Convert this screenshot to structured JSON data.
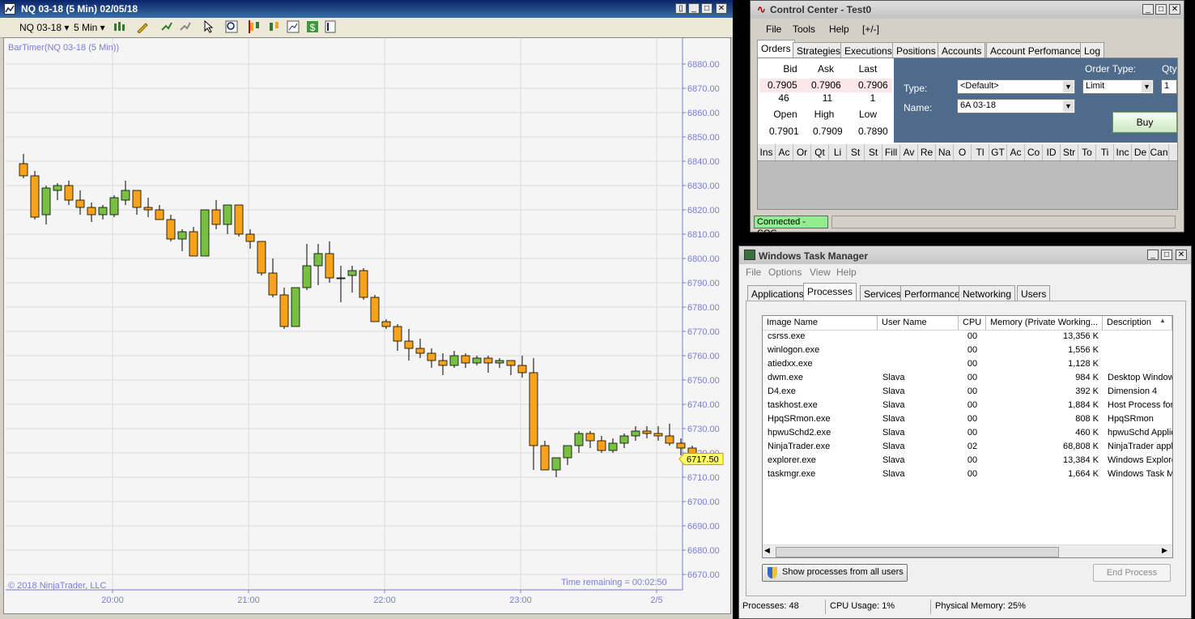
{
  "chart_window": {
    "title": "NQ 03-18 (5 Min)  02/05/18",
    "instrument": "NQ 03-18",
    "interval": "5 Min",
    "indicator_label": "BarTimer(NQ 03-18 (5 Min))",
    "copyright": "© 2018 NinjaTrader, LLC",
    "time_remaining": "Time remaining = 00:02:50",
    "last_price": "6717.50",
    "icons": [
      "bar-type-icon",
      "draw-pencil-icon",
      "add-indicator-icon",
      "strategy-icon",
      "cursor-icon",
      "zoom-icon",
      "chart-style-icon",
      "data-box-icon",
      "panel-icon",
      "dollar-icon",
      "properties-icon"
    ]
  },
  "chart_data": {
    "type": "candlestick",
    "title": "",
    "xlabel": "",
    "ylabel": "",
    "ylim": [
      6665,
      6885
    ],
    "y_ticks": [
      "6880.00",
      "6870.00",
      "6860.00",
      "6850.00",
      "6840.00",
      "6830.00",
      "6820.00",
      "6810.00",
      "6800.00",
      "6790.00",
      "6780.00",
      "6770.00",
      "6760.00",
      "6750.00",
      "6740.00",
      "6730.00",
      "6720.00",
      "6710.00",
      "6700.00",
      "6690.00",
      "6680.00",
      "6670.00"
    ],
    "y_tick_values": [
      6880,
      6870,
      6860,
      6850,
      6840,
      6830,
      6820,
      6810,
      6800,
      6790,
      6780,
      6770,
      6760,
      6750,
      6740,
      6730,
      6720,
      6710,
      6700,
      6690,
      6680,
      6670
    ],
    "x_ticks": [
      "20:00",
      "21:00",
      "22:00",
      "23:00",
      "2/5"
    ],
    "x_tick_bar_index": [
      8,
      20,
      32,
      44,
      56
    ],
    "up_color": "#78c042",
    "down_color": "#f7a21b",
    "candles": [
      {
        "o": 6839.0,
        "h": 6843.0,
        "l": 6833.0,
        "c": 6834.0
      },
      {
        "o": 6834.0,
        "h": 6836.0,
        "l": 6816.0,
        "c": 6817.0
      },
      {
        "o": 6818.0,
        "h": 6830.0,
        "l": 6814.0,
        "c": 6829.0
      },
      {
        "o": 6828.0,
        "h": 6831.0,
        "l": 6824.0,
        "c": 6830.0
      },
      {
        "o": 6830.0,
        "h": 6832.0,
        "l": 6822.0,
        "c": 6824.0
      },
      {
        "o": 6824.0,
        "h": 6828.0,
        "l": 6818.0,
        "c": 6821.0
      },
      {
        "o": 6821.0,
        "h": 6823.0,
        "l": 6815.0,
        "c": 6818.0
      },
      {
        "o": 6818.0,
        "h": 6822.0,
        "l": 6816.0,
        "c": 6821.0
      },
      {
        "o": 6818.0,
        "h": 6826.0,
        "l": 6817.0,
        "c": 6825.0
      },
      {
        "o": 6824.0,
        "h": 6832.0,
        "l": 6822.0,
        "c": 6828.0
      },
      {
        "o": 6828.0,
        "h": 6828.0,
        "l": 6818.0,
        "c": 6821.0
      },
      {
        "o": 6821.0,
        "h": 6825.0,
        "l": 6817.0,
        "c": 6820.0
      },
      {
        "o": 6820.0,
        "h": 6822.0,
        "l": 6816.0,
        "c": 6816.0
      },
      {
        "o": 6816.0,
        "h": 6818.0,
        "l": 6807.0,
        "c": 6808.0
      },
      {
        "o": 6808.0,
        "h": 6812.0,
        "l": 6803.0,
        "c": 6811.0
      },
      {
        "o": 6811.0,
        "h": 6813.0,
        "l": 6801.0,
        "c": 6801.0
      },
      {
        "o": 6801.0,
        "h": 6818.0,
        "l": 6801.0,
        "c": 6820.0
      },
      {
        "o": 6820.0,
        "h": 6824.0,
        "l": 6812.0,
        "c": 6814.0
      },
      {
        "o": 6814.0,
        "h": 6822.0,
        "l": 6810.0,
        "c": 6822.0
      },
      {
        "o": 6822.0,
        "h": 6822.0,
        "l": 6809.0,
        "c": 6810.0
      },
      {
        "o": 6810.0,
        "h": 6812.0,
        "l": 6804.0,
        "c": 6807.0
      },
      {
        "o": 6807.0,
        "h": 6807.0,
        "l": 6793.0,
        "c": 6794.0
      },
      {
        "o": 6794.0,
        "h": 6800.0,
        "l": 6784.0,
        "c": 6785.0
      },
      {
        "o": 6785.0,
        "h": 6788.0,
        "l": 6771.0,
        "c": 6772.0
      },
      {
        "o": 6772.0,
        "h": 6788.0,
        "l": 6772.0,
        "c": 6788.0
      },
      {
        "o": 6788.0,
        "h": 6806.0,
        "l": 6787.0,
        "c": 6797.0
      },
      {
        "o": 6797.0,
        "h": 6806.0,
        "l": 6789.0,
        "c": 6802.0
      },
      {
        "o": 6802.0,
        "h": 6807.0,
        "l": 6790.0,
        "c": 6792.0
      },
      {
        "o": 6792.0,
        "h": 6797.0,
        "l": 6782.0,
        "c": 6792.0
      },
      {
        "o": 6793.0,
        "h": 6797.0,
        "l": 6786.0,
        "c": 6795.0
      },
      {
        "o": 6795.0,
        "h": 6796.0,
        "l": 6783.0,
        "c": 6784.0
      },
      {
        "o": 6784.0,
        "h": 6785.0,
        "l": 6774.0,
        "c": 6774.0
      },
      {
        "o": 6774.0,
        "h": 6775.0,
        "l": 6771.0,
        "c": 6772.0
      },
      {
        "o": 6772.0,
        "h": 6773.0,
        "l": 6762.0,
        "c": 6766.0
      },
      {
        "o": 6766.0,
        "h": 6771.0,
        "l": 6758.0,
        "c": 6763.0
      },
      {
        "o": 6763.0,
        "h": 6767.0,
        "l": 6759.0,
        "c": 6761.0
      },
      {
        "o": 6761.0,
        "h": 6763.0,
        "l": 6755.0,
        "c": 6758.0
      },
      {
        "o": 6758.0,
        "h": 6761.0,
        "l": 6752.0,
        "c": 6756.0
      },
      {
        "o": 6756.0,
        "h": 6762.0,
        "l": 6755.0,
        "c": 6760.0
      },
      {
        "o": 6760.0,
        "h": 6761.0,
        "l": 6755.0,
        "c": 6757.0
      },
      {
        "o": 6757.0,
        "h": 6760.0,
        "l": 6756.0,
        "c": 6759.0
      },
      {
        "o": 6759.0,
        "h": 6760.0,
        "l": 6753.0,
        "c": 6757.0
      },
      {
        "o": 6757.0,
        "h": 6759.0,
        "l": 6755.0,
        "c": 6758.0
      },
      {
        "o": 6758.0,
        "h": 6758.0,
        "l": 6752.0,
        "c": 6756.0
      },
      {
        "o": 6756.0,
        "h": 6760.0,
        "l": 6751.0,
        "c": 6753.0
      },
      {
        "o": 6753.0,
        "h": 6759.0,
        "l": 6713.0,
        "c": 6723.0
      },
      {
        "o": 6723.0,
        "h": 6725.0,
        "l": 6713.0,
        "c": 6713.0
      },
      {
        "o": 6713.0,
        "h": 6718.0,
        "l": 6710.0,
        "c": 6718.0
      },
      {
        "o": 6718.0,
        "h": 6723.0,
        "l": 6715.0,
        "c": 6723.0
      },
      {
        "o": 6723.0,
        "h": 6729.0,
        "l": 6720.0,
        "c": 6728.0
      },
      {
        "o": 6728.0,
        "h": 6729.0,
        "l": 6722.0,
        "c": 6725.0
      },
      {
        "o": 6725.0,
        "h": 6727.0,
        "l": 6720.0,
        "c": 6721.0
      },
      {
        "o": 6721.0,
        "h": 6726.0,
        "l": 6720.0,
        "c": 6724.0
      },
      {
        "o": 6724.0,
        "h": 6728.0,
        "l": 6722.0,
        "c": 6727.0
      },
      {
        "o": 6727.0,
        "h": 6731.0,
        "l": 6725.0,
        "c": 6729.0
      },
      {
        "o": 6729.0,
        "h": 6731.0,
        "l": 6726.0,
        "c": 6728.0
      },
      {
        "o": 6728.0,
        "h": 6731.0,
        "l": 6725.0,
        "c": 6727.0
      },
      {
        "o": 6727.0,
        "h": 6732.0,
        "l": 6723.0,
        "c": 6724.0
      },
      {
        "o": 6724.0,
        "h": 6726.0,
        "l": 6719.0,
        "c": 6722.0
      },
      {
        "o": 6722.0,
        "h": 6723.0,
        "l": 6716.0,
        "c": 6717.5
      }
    ]
  },
  "control_center": {
    "title": "Control Center - Test0",
    "menu": [
      "File",
      "Tools",
      "Help",
      "[+/-]"
    ],
    "tabs": [
      "Orders",
      "Strategies",
      "Executions",
      "Positions",
      "Accounts",
      "Account Perfomance",
      "Log"
    ],
    "quote": {
      "headers1": [
        "Bid",
        "Ask",
        "Last"
      ],
      "prices": [
        "0.7905",
        "0.7906",
        "0.7906"
      ],
      "sizes": [
        "46",
        "11",
        "1"
      ],
      "headers2": [
        "Open",
        "High",
        "Low"
      ],
      "ohl": [
        "0.7901",
        "0.7909",
        "0.7890"
      ]
    },
    "order_type_label": "Order Type:",
    "qty_label": "Qty",
    "type_label": "Type:",
    "type_value": "<Default>",
    "name_label": "Name:",
    "name_value": "6A 03-18",
    "order_type_value": "Limit",
    "qty_value": "1",
    "buy_label": "Buy",
    "grid_columns": [
      "Ins",
      "Ac",
      "Or",
      "Qt",
      "Li",
      "St",
      "St",
      "Fill",
      "Av",
      "Re",
      "Na",
      "O",
      "Tl",
      "GT",
      "Ac",
      "Co",
      "ID",
      "Str",
      "To",
      "Ti",
      "Inc",
      "De",
      "Can"
    ],
    "status": "Connected - CQG",
    "accent": "#8b0000"
  },
  "task_manager": {
    "title": "Windows Task Manager",
    "menu": [
      "File",
      "Options",
      "View",
      "Help"
    ],
    "tabs": [
      "Applications",
      "Processes",
      "Services",
      "Performance",
      "Networking",
      "Users"
    ],
    "columns": [
      "Image Name",
      "User Name",
      "CPU",
      "Memory (Private Working...",
      "Description"
    ],
    "rows": [
      {
        "name": "csrss.exe",
        "user": "",
        "cpu": "00",
        "mem": "13,356 K",
        "desc": ""
      },
      {
        "name": "winlogon.exe",
        "user": "",
        "cpu": "00",
        "mem": "1,556 K",
        "desc": ""
      },
      {
        "name": "atiedxx.exe",
        "user": "",
        "cpu": "00",
        "mem": "1,128 K",
        "desc": ""
      },
      {
        "name": "dwm.exe",
        "user": "Slava",
        "cpu": "00",
        "mem": "984 K",
        "desc": "Desktop Window"
      },
      {
        "name": "D4.exe",
        "user": "Slava",
        "cpu": "00",
        "mem": "392 K",
        "desc": "Dimension 4"
      },
      {
        "name": "taskhost.exe",
        "user": "Slava",
        "cpu": "00",
        "mem": "1,884 K",
        "desc": "Host Process for"
      },
      {
        "name": "HpqSRmon.exe",
        "user": "Slava",
        "cpu": "00",
        "mem": "808 K",
        "desc": "HpqSRmon"
      },
      {
        "name": "hpwuSchd2.exe",
        "user": "Slava",
        "cpu": "00",
        "mem": "460 K",
        "desc": "hpwuSchd Applic"
      },
      {
        "name": "NinjaTrader.exe",
        "user": "Slava",
        "cpu": "02",
        "mem": "68,808 K",
        "desc": "NinjaTrader appl"
      },
      {
        "name": "explorer.exe",
        "user": "Slava",
        "cpu": "00",
        "mem": "13,384 K",
        "desc": "Windows Explore"
      },
      {
        "name": "taskmgr.exe",
        "user": "Slava",
        "cpu": "00",
        "mem": "1,664 K",
        "desc": "Windows Task M"
      }
    ],
    "show_all_label": "Show processes from all users",
    "end_process_label": "End Process",
    "status_processes": "Processes: 48",
    "status_cpu": "CPU Usage: 1%",
    "status_memory": "Physical Memory: 25%"
  }
}
